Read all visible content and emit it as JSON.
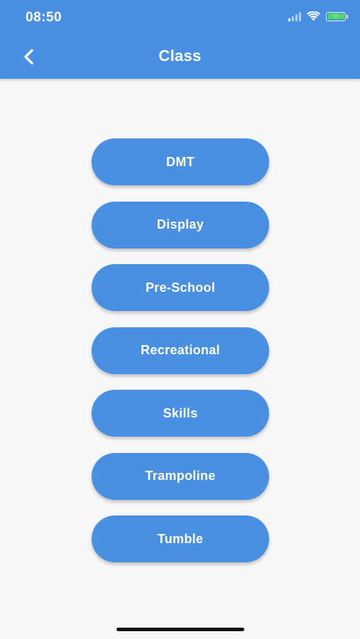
{
  "status_bar": {
    "time": "08:50",
    "icons": [
      "signal-icon",
      "wifi-icon",
      "battery-charging-icon"
    ],
    "battery_color": "#4cd964"
  },
  "header": {
    "title": "Class",
    "back_icon": "chevron-left-icon",
    "background_color": "#4a90e2"
  },
  "classes": [
    {
      "label": "DMT"
    },
    {
      "label": "Display"
    },
    {
      "label": "Pre-School"
    },
    {
      "label": "Recreational"
    },
    {
      "label": "Skills"
    },
    {
      "label": "Trampoline"
    },
    {
      "label": "Tumble"
    }
  ],
  "colors": {
    "accent": "#4a90e2",
    "background": "#f7f7f7",
    "button_text": "#ffffff"
  }
}
